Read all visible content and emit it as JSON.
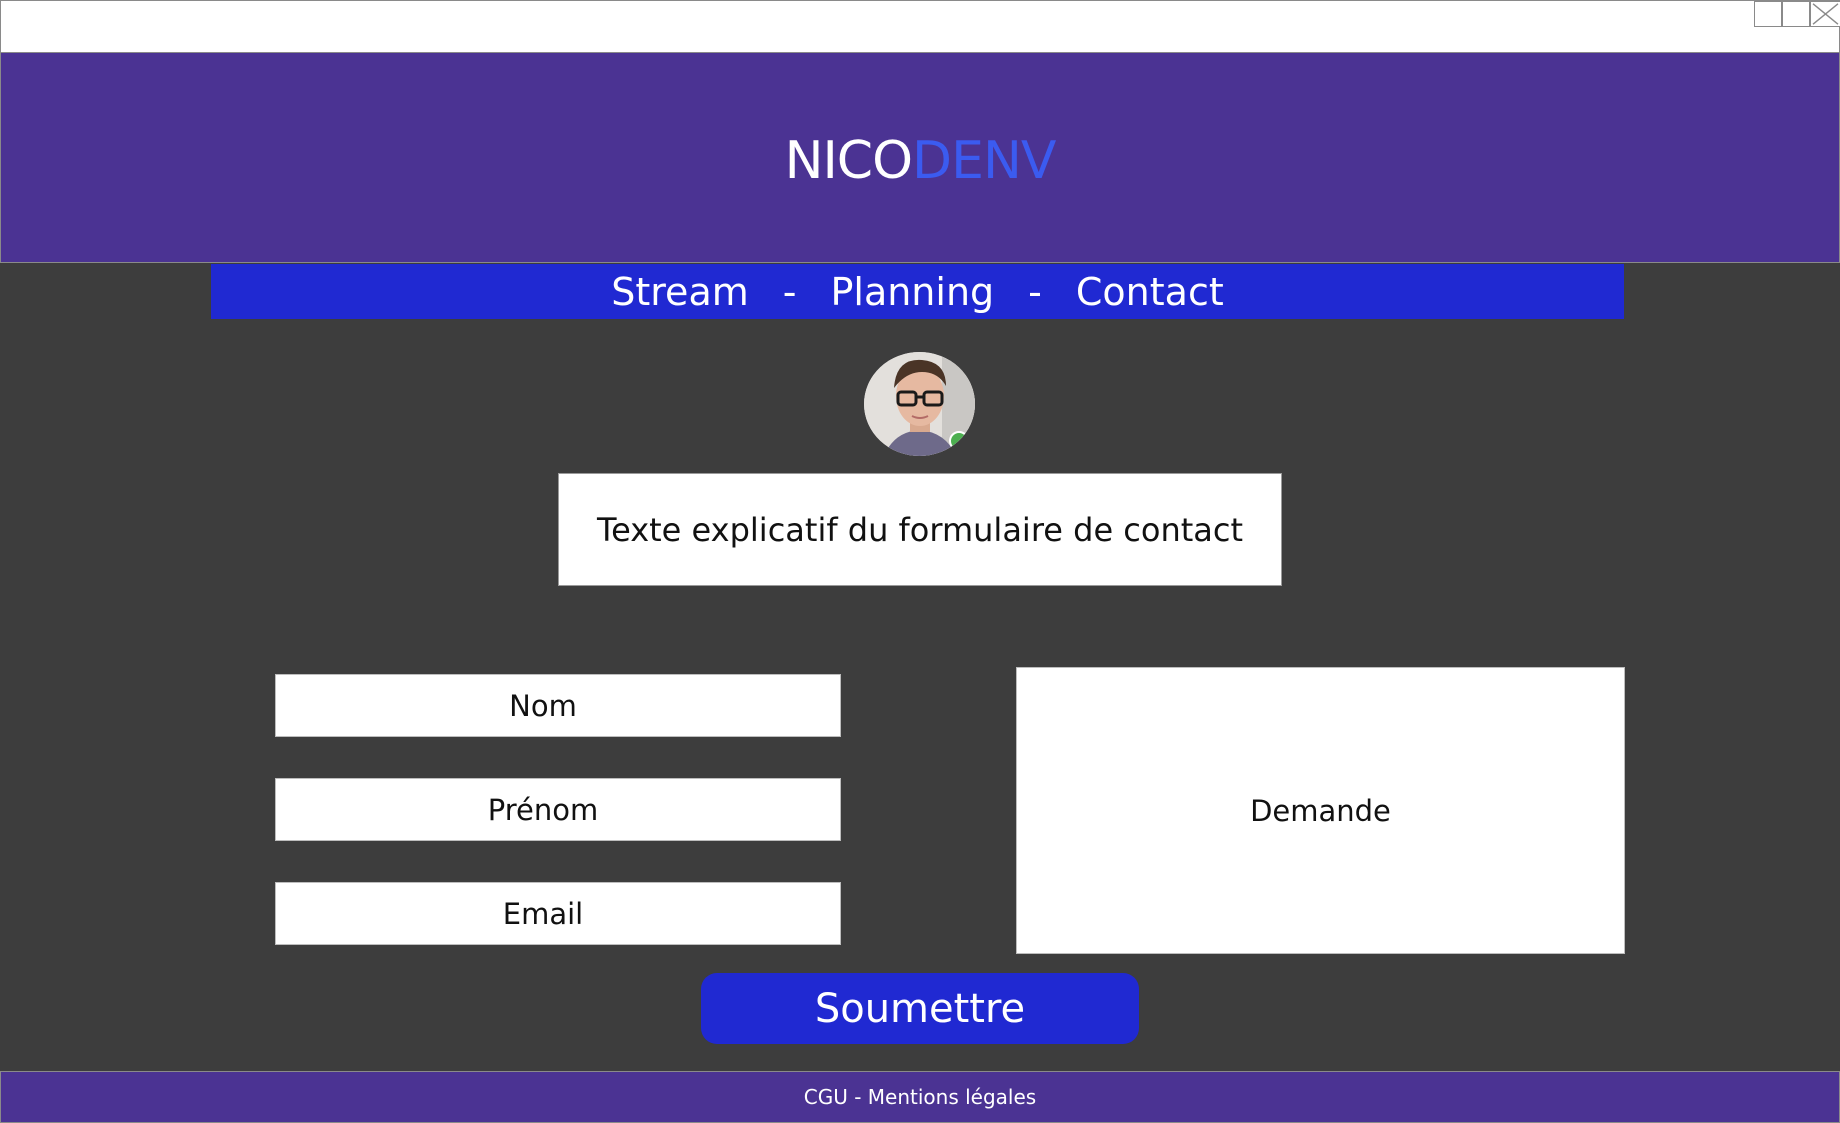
{
  "brand": {
    "part1": "NICO",
    "part2": "DENV",
    "color_part1": "#ffffff",
    "color_part2": "#3b5bf0"
  },
  "nav": {
    "items": [
      {
        "label": "Stream"
      },
      {
        "label": "Planning"
      },
      {
        "label": "Contact"
      }
    ],
    "separator": "-"
  },
  "avatar": {
    "icon": "profile-photo"
  },
  "contact": {
    "intro_text": "Texte explicatif du formulaire de contact",
    "fields": {
      "nom": "Nom",
      "prenom": "Prénom",
      "email": "Email",
      "demande": "Demande"
    },
    "submit_label": "Soumettre"
  },
  "footer": {
    "text": "CGU - Mentions légales"
  },
  "colors": {
    "header_bg": "#4b3393",
    "nav_bg": "#2029d2",
    "page_bg": "#3d3d3d",
    "button_bg": "#2029d2"
  }
}
